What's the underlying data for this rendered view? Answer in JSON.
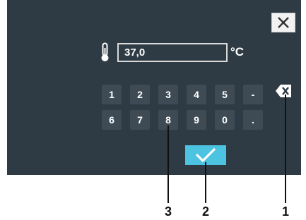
{
  "dialog": {
    "value": "37,0",
    "unit": "°C",
    "close_icon": "close-icon",
    "thermometer_icon": "thermometer-icon",
    "backspace_icon": "backspace-icon",
    "confirm_icon": "check-icon",
    "confirm_color": "#4cc3e0"
  },
  "keypad": {
    "row1": [
      "1",
      "2",
      "3",
      "4",
      "5",
      "-"
    ],
    "row2": [
      "6",
      "7",
      "8",
      "9",
      "0",
      "."
    ]
  },
  "callouts": [
    "3",
    "2",
    "1"
  ]
}
